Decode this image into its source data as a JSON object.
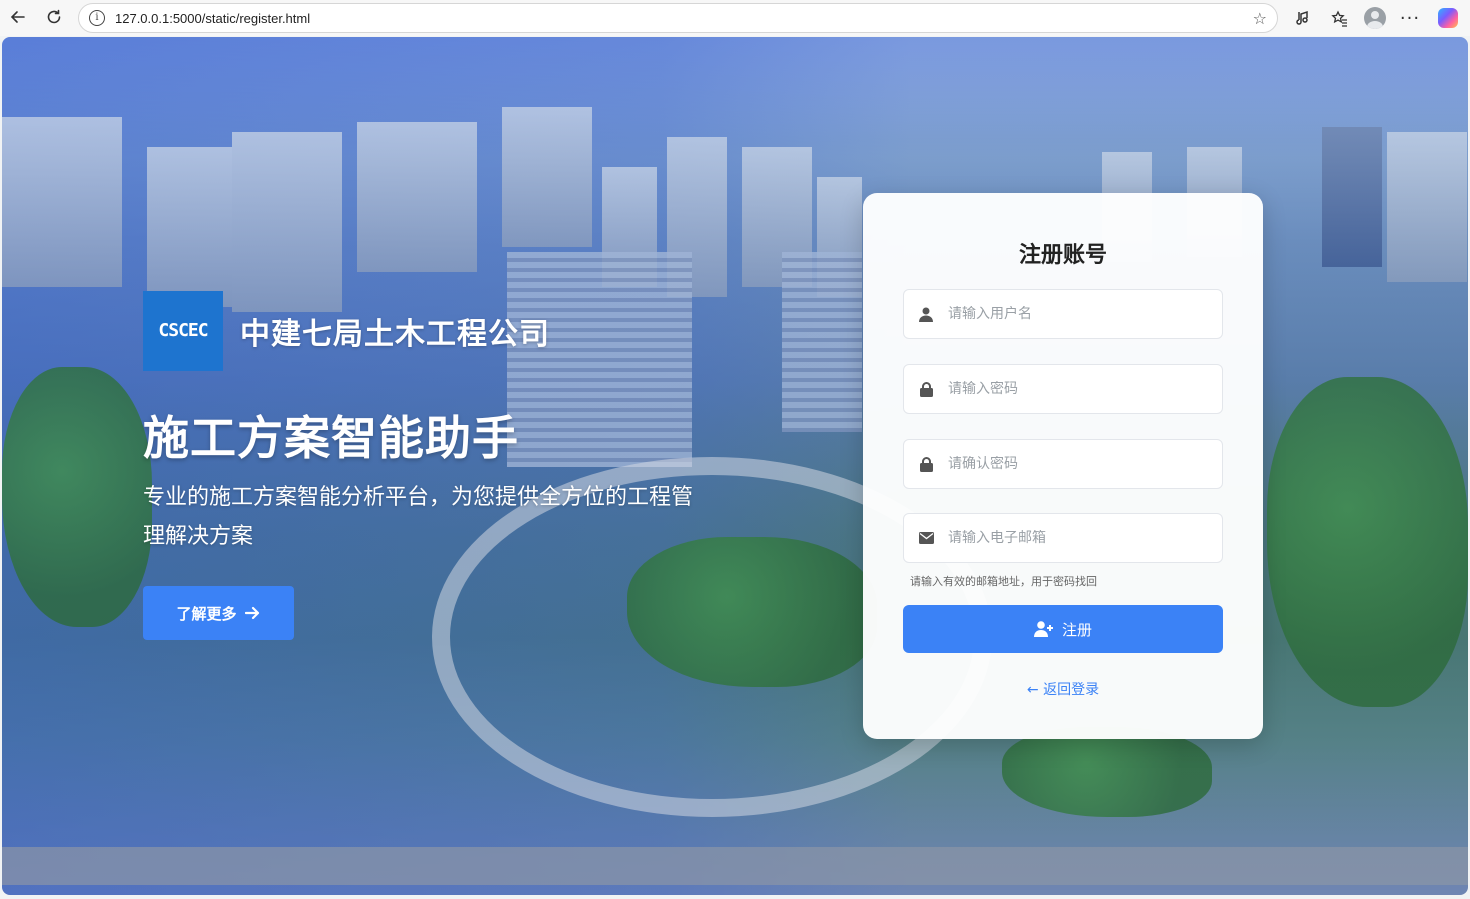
{
  "browser": {
    "url": "127.0.0.1:5000/static/register.html"
  },
  "hero": {
    "company_name": "中建七局土木工程公司",
    "logo_text": "CSCEC",
    "title": "施工方案智能助手",
    "subtitle": "专业的施工方案智能分析平台，为您提供全方位的工程管理解决方案",
    "learn_more": "了解更多"
  },
  "register": {
    "title": "注册账号",
    "username_placeholder": "请输入用户名",
    "password_placeholder": "请输入密码",
    "confirm_placeholder": "请确认密码",
    "email_placeholder": "请输入电子邮箱",
    "email_hint": "请输入有效的邮箱地址，用于密码找回",
    "submit_label": "注册",
    "back_label": "返回登录"
  },
  "colors": {
    "accent": "#3b82f6",
    "logo_bg": "#1e74cf"
  }
}
